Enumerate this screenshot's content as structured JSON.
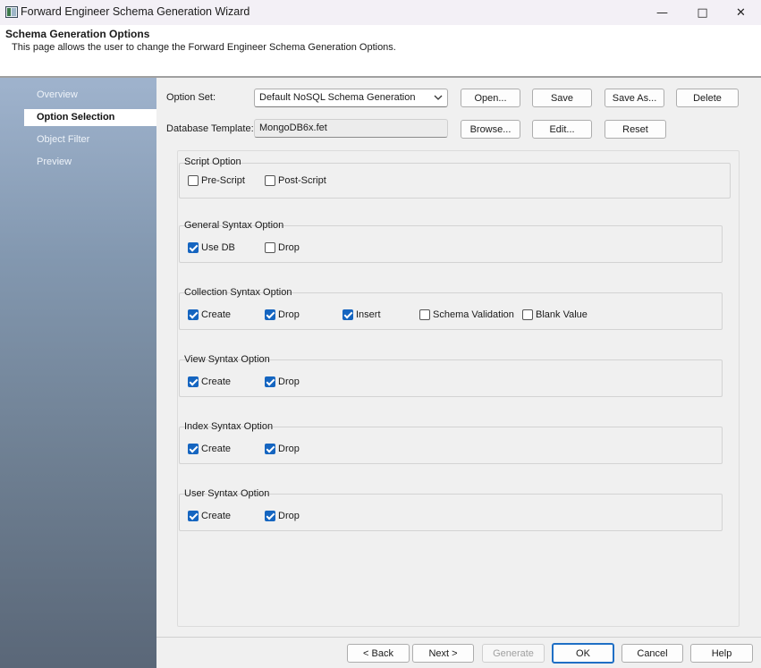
{
  "window": {
    "title": "Forward Engineer Schema Generation Wizard"
  },
  "window_controls": {
    "minimize": "—",
    "maximize": "□",
    "close": "✕"
  },
  "header": {
    "title": "Schema Generation Options",
    "description": "This page allows the user to change the Forward Engineer Schema Generation Options."
  },
  "sidebar": {
    "items": [
      {
        "label": "Overview",
        "active": false
      },
      {
        "label": "Option Selection",
        "active": true
      },
      {
        "label": "Object Filter",
        "active": false
      },
      {
        "label": "Preview",
        "active": false
      }
    ]
  },
  "option_set": {
    "label": "Option Set:",
    "value": "Default NoSQL Schema Generation",
    "buttons": {
      "open": "Open...",
      "save": "Save",
      "save_as": "Save As...",
      "delete": "Delete"
    }
  },
  "database_template": {
    "label": "Database Template:",
    "value": "MongoDB6x.fet",
    "buttons": {
      "browse": "Browse...",
      "edit": "Edit...",
      "reset": "Reset"
    }
  },
  "groups": {
    "script": {
      "title": "Script Option",
      "options": [
        {
          "label": "Pre-Script",
          "checked": false
        },
        {
          "label": "Post-Script",
          "checked": false
        }
      ]
    },
    "general": {
      "title": "General Syntax Option",
      "options": [
        {
          "label": "Use DB",
          "checked": true
        },
        {
          "label": "Drop",
          "checked": false
        }
      ]
    },
    "collection": {
      "title": "Collection Syntax Option",
      "options": [
        {
          "label": "Create",
          "checked": true
        },
        {
          "label": "Drop",
          "checked": true
        },
        {
          "label": "Insert",
          "checked": true
        },
        {
          "label": "Schema Validation",
          "checked": false
        },
        {
          "label": "Blank Value",
          "checked": false
        }
      ]
    },
    "view": {
      "title": "View Syntax Option",
      "options": [
        {
          "label": "Create",
          "checked": true
        },
        {
          "label": "Drop",
          "checked": true
        }
      ]
    },
    "index": {
      "title": "Index Syntax Option",
      "options": [
        {
          "label": "Create",
          "checked": true
        },
        {
          "label": "Drop",
          "checked": true
        }
      ]
    },
    "user": {
      "title": "User Syntax Option",
      "options": [
        {
          "label": "Create",
          "checked": true
        },
        {
          "label": "Drop",
          "checked": true
        }
      ]
    }
  },
  "footer": {
    "back": "< Back",
    "next": "Next >",
    "generate": "Generate",
    "ok": "OK",
    "cancel": "Cancel",
    "help": "Help"
  },
  "colors": {
    "accent": "#1565c0",
    "sidebar_top": "#9fb3cd",
    "sidebar_bottom": "#5a6778"
  }
}
